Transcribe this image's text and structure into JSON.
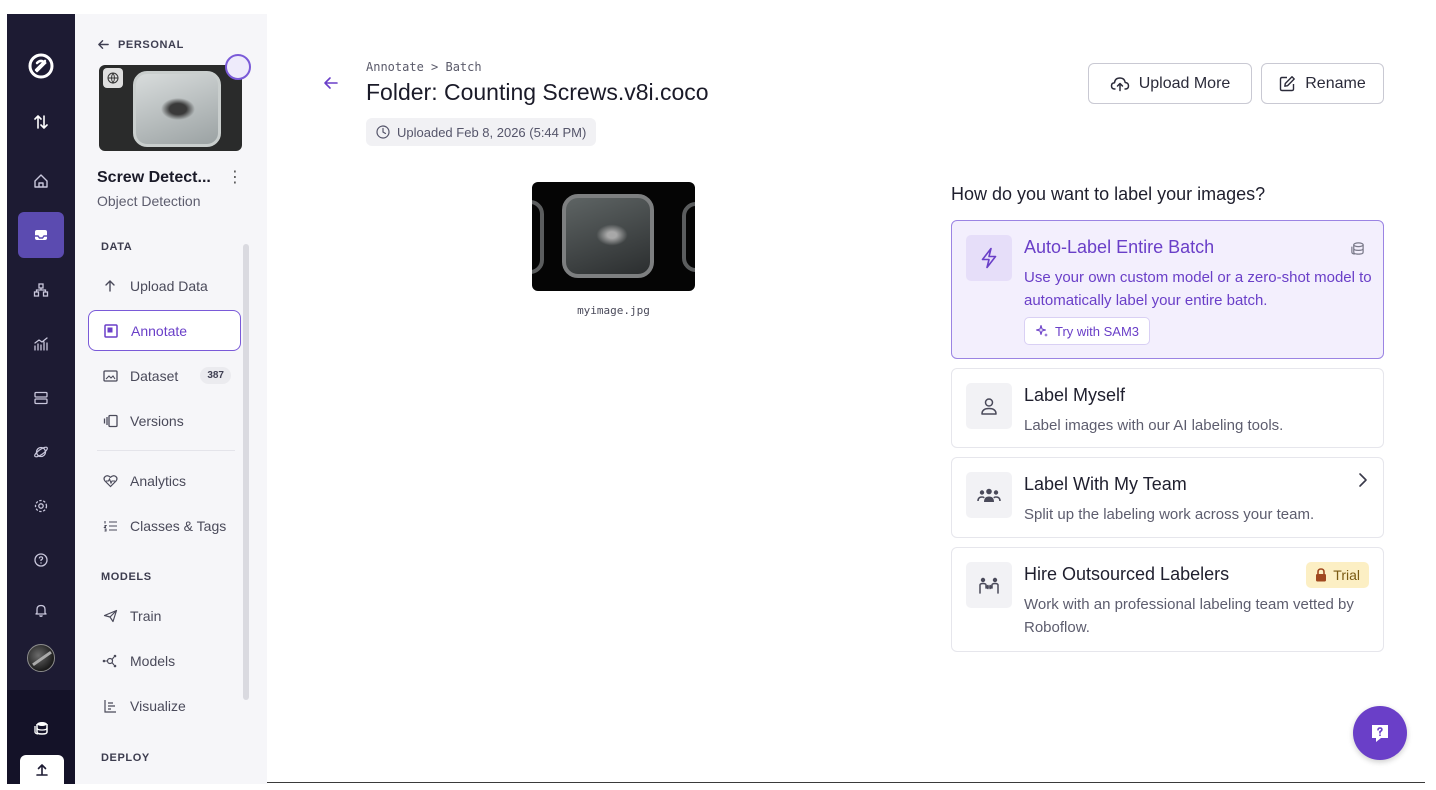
{
  "sidebar": {
    "back_label": "PERSONAL",
    "project_name": "Screw Detect...",
    "project_type": "Object Detection",
    "sections": {
      "data": "DATA",
      "models": "MODELS",
      "deploy": "DEPLOY"
    },
    "items": {
      "upload": "Upload Data",
      "annotate": "Annotate",
      "dataset": "Dataset",
      "dataset_count": "387",
      "versions": "Versions",
      "analytics": "Analytics",
      "classes": "Classes & Tags",
      "train": "Train",
      "models": "Models",
      "visualize": "Visualize"
    }
  },
  "header": {
    "breadcrumb": "Annotate > Batch",
    "title": "Folder: Counting Screws.v8i.coco",
    "uploaded": "Uploaded Feb 8, 2026 (5:44 PM)",
    "upload_more_label": "Upload More",
    "rename_label": "Rename"
  },
  "preview": {
    "filename": "myimage.jpg"
  },
  "labeling": {
    "question": "How do you want to label your images?",
    "options": [
      {
        "title": "Auto-Label Entire Batch",
        "description": "Use your own custom model or a zero-shot model to automatically label your entire batch.",
        "cta": "Try with SAM3"
      },
      {
        "title": "Label Myself",
        "description": "Label images with our AI labeling tools."
      },
      {
        "title": "Label With My Team",
        "description": "Split up the labeling work across your team."
      },
      {
        "title": "Hire Outsourced Labelers",
        "description": "Work with an professional labeling team vetted by Roboflow.",
        "badge": "Trial"
      }
    ]
  },
  "colors": {
    "accent": "#6a3fc8",
    "rail_bg": "#1d1b33",
    "trial_bg": "#fcefc4"
  }
}
